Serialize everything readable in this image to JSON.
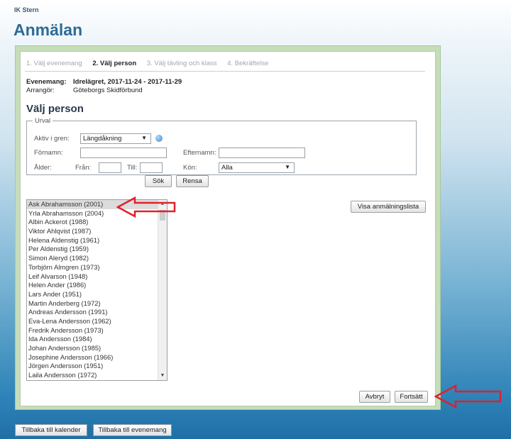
{
  "club_name": "IK Stern",
  "page_title": "Anmälan",
  "steps": [
    {
      "label": "1. Välj evenemang",
      "active": false
    },
    {
      "label": "2. Välj person",
      "active": true
    },
    {
      "label": "3. Välj tävling och klass",
      "active": false
    },
    {
      "label": "4. Bekräftelse",
      "active": false
    }
  ],
  "event": {
    "label": "Evenemang:",
    "value": "Idrelägret, 2017-11-24 - 2017-11-29",
    "organizer_label": "Arrangör:",
    "organizer_value": "Göteborgs Skidförbund"
  },
  "section_title": "Välj person",
  "filter": {
    "legend": "Urval",
    "branch_label": "Aktiv i gren:",
    "branch_value": "Längdåkning",
    "firstname_label": "Förnamn:",
    "firstname_value": "",
    "lastname_label": "Efternamn:",
    "lastname_value": "",
    "age_label": "Ålder:",
    "from_label": "Från:",
    "from_value": "",
    "to_label": "Till:",
    "to_value": "",
    "gender_label": "Kön:",
    "gender_value": "Alla",
    "search_button": "Sök",
    "clear_button": "Rensa"
  },
  "persons": [
    "Ask Abrahamsson (2001)",
    "Yrla Abrahamsson (2004)",
    "Albin Ackerot (1988)",
    "Viktor Ahlqvist (1987)",
    "Helena Aldenstig (1961)",
    "Per Aldenstig (1959)",
    "Simon Aleryd (1982)",
    "Torbjörn Almgren (1973)",
    "Leif Alvarson (1948)",
    "Helen Ander (1986)",
    "Lars Ander (1951)",
    "Martin Anderberg (1972)",
    "Andreas Andersson (1991)",
    "Eva-Lena Andersson (1962)",
    "Fredrik Andersson (1973)",
    "Ida Andersson (1984)",
    "Johan Andersson (1985)",
    "Josephine Andersson (1966)",
    "Jörgen Andersson (1951)",
    "Laila Andersson (1972)"
  ],
  "show_list_button": "Visa anmälningslista",
  "cancel_button": "Avbryt",
  "continue_button": "Fortsätt",
  "back_calendar_button": "Tillbaka till kalender",
  "back_events_button": "Tillbaka till evenemang",
  "colors": {
    "title": "#2d6b96",
    "frame": "#c5deb9",
    "arrow": "#e0202a"
  }
}
